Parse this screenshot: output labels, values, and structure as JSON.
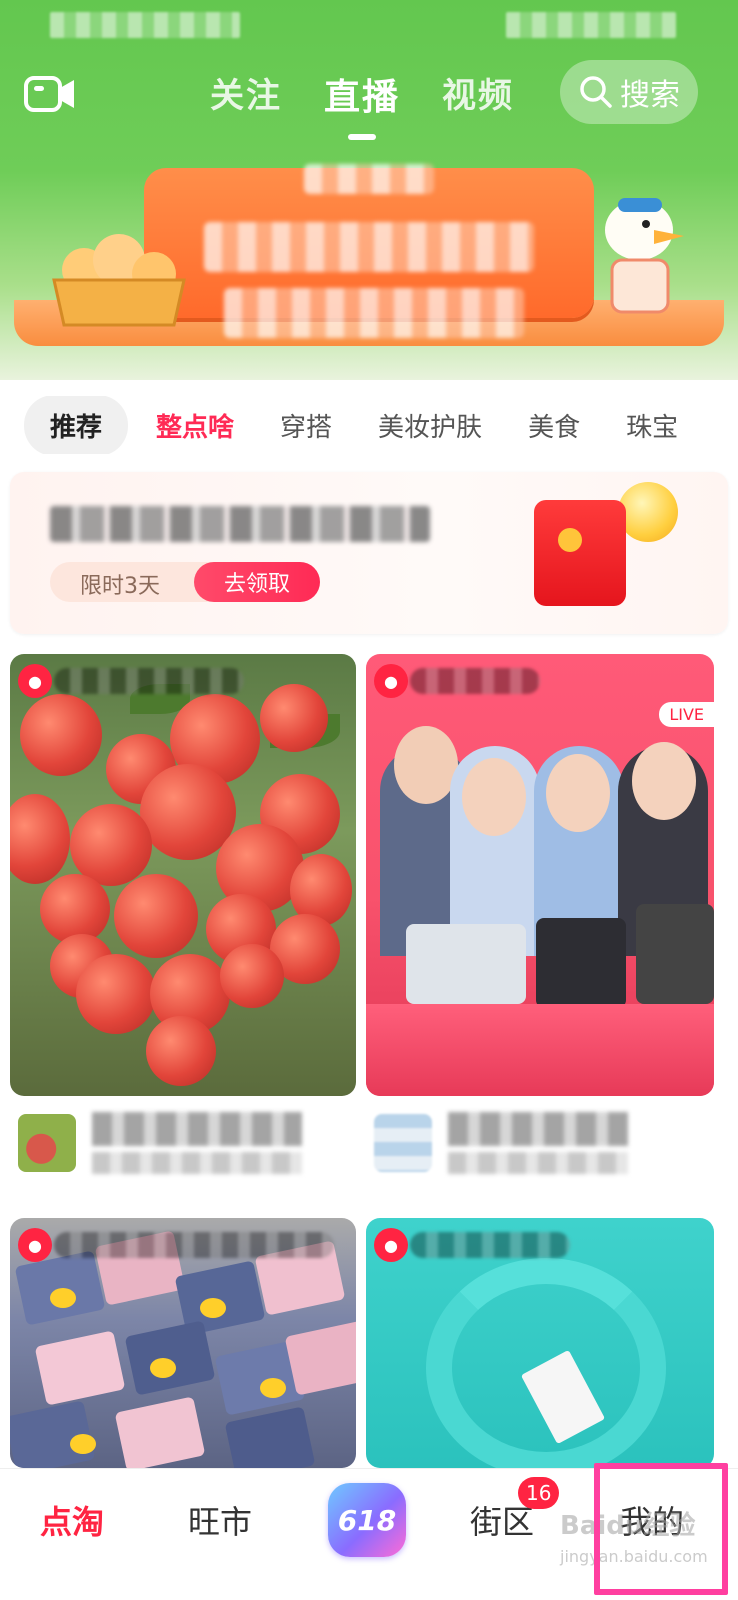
{
  "header": {
    "tabs": [
      {
        "label": "关注"
      },
      {
        "label": "直播",
        "active": true
      },
      {
        "label": "视频"
      }
    ],
    "search_label": "搜索",
    "icons": {
      "camera": "video-camera-icon",
      "search": "search-icon"
    }
  },
  "categories": [
    {
      "label": "推荐",
      "state": "active"
    },
    {
      "label": "整点啥",
      "state": "highlight"
    },
    {
      "label": "穿搭"
    },
    {
      "label": "美妆护肤"
    },
    {
      "label": "美食"
    },
    {
      "label": "珠宝"
    }
  ],
  "promo": {
    "time_label": "限时3天",
    "claim_label": "去领取"
  },
  "cards": [
    {
      "live_tag": "LIVE"
    }
  ],
  "bottom_nav": {
    "items": [
      {
        "label": "点淘",
        "active": true
      },
      {
        "label": "旺市"
      },
      {
        "label": "618"
      },
      {
        "label": "街区",
        "badge": "16"
      },
      {
        "label": "我的"
      }
    ]
  },
  "watermark": {
    "text": "Baidu经验",
    "sub": "jingyan.baidu.com"
  },
  "colors": {
    "header_green": "#63c74f",
    "accent_red": "#ff2442",
    "highlight_pink": "#ff3fa0"
  }
}
